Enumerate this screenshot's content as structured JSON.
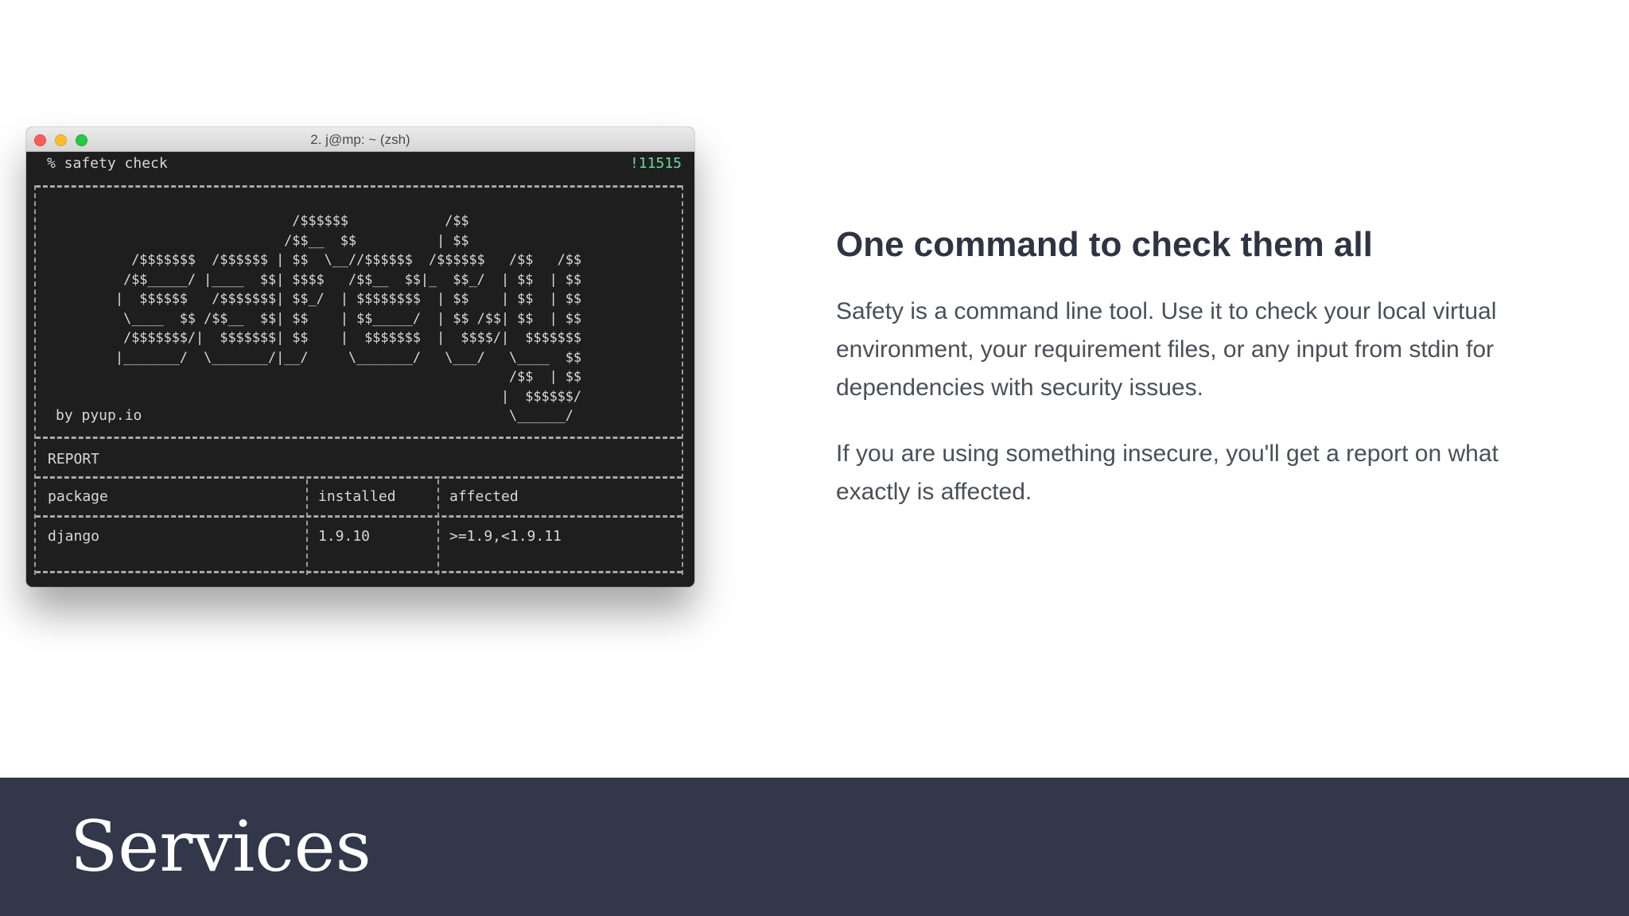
{
  "terminal": {
    "window_title": "2. j@mp: ~ (zsh)",
    "prompt": "% safety check",
    "prompt_counter": "!11515",
    "ascii_logo": "                      /$$$$$$            /$$\n                     /$$__  $$          | $$\n  /$$$$$$$  /$$$$$$ | $$  \\__//$$$$$$  /$$$$$$   /$$   /$$\n /$$_____/ |____  $$| $$$$   /$$__  $$|_  $$_/  | $$  | $$\n|  $$$$$$   /$$$$$$$| $$_/  | $$$$$$$$  | $$    | $$  | $$\n \\____  $$ /$$__  $$| $$    | $$_____/  | $$ /$$| $$  | $$\n /$$$$$$$/|  $$$$$$$| $$    |  $$$$$$$  |  $$$$/|  $$$$$$$\n|_______/  \\_______/|__/     \\_______/   \\___/   \\____  $$\n                                                 /$$  | $$\n                                                |  $$$$$$/\n                                                 \\______/",
    "byline": "by pyup.io",
    "report_label": "REPORT",
    "table": {
      "headers": [
        "package",
        "installed",
        "affected"
      ],
      "rows": [
        [
          "django",
          "1.9.10",
          ">=1.9,<1.9.11"
        ]
      ]
    }
  },
  "content": {
    "heading": "One command to check them all",
    "paragraphs": [
      "Safety is a command line tool. Use it to check your local virtual environment, your requirement files, or any input from stdin for dependencies with security issues.",
      "If you are using something insecure, you'll get a report on what exactly is affected."
    ]
  },
  "footer": {
    "title": "Services"
  },
  "colors": {
    "footer_bg": "#323849",
    "heading": "#2f3442",
    "body_text": "#4b4f58",
    "terminal_bg": "#1e1e1e",
    "counter": "#6fd6a0"
  }
}
